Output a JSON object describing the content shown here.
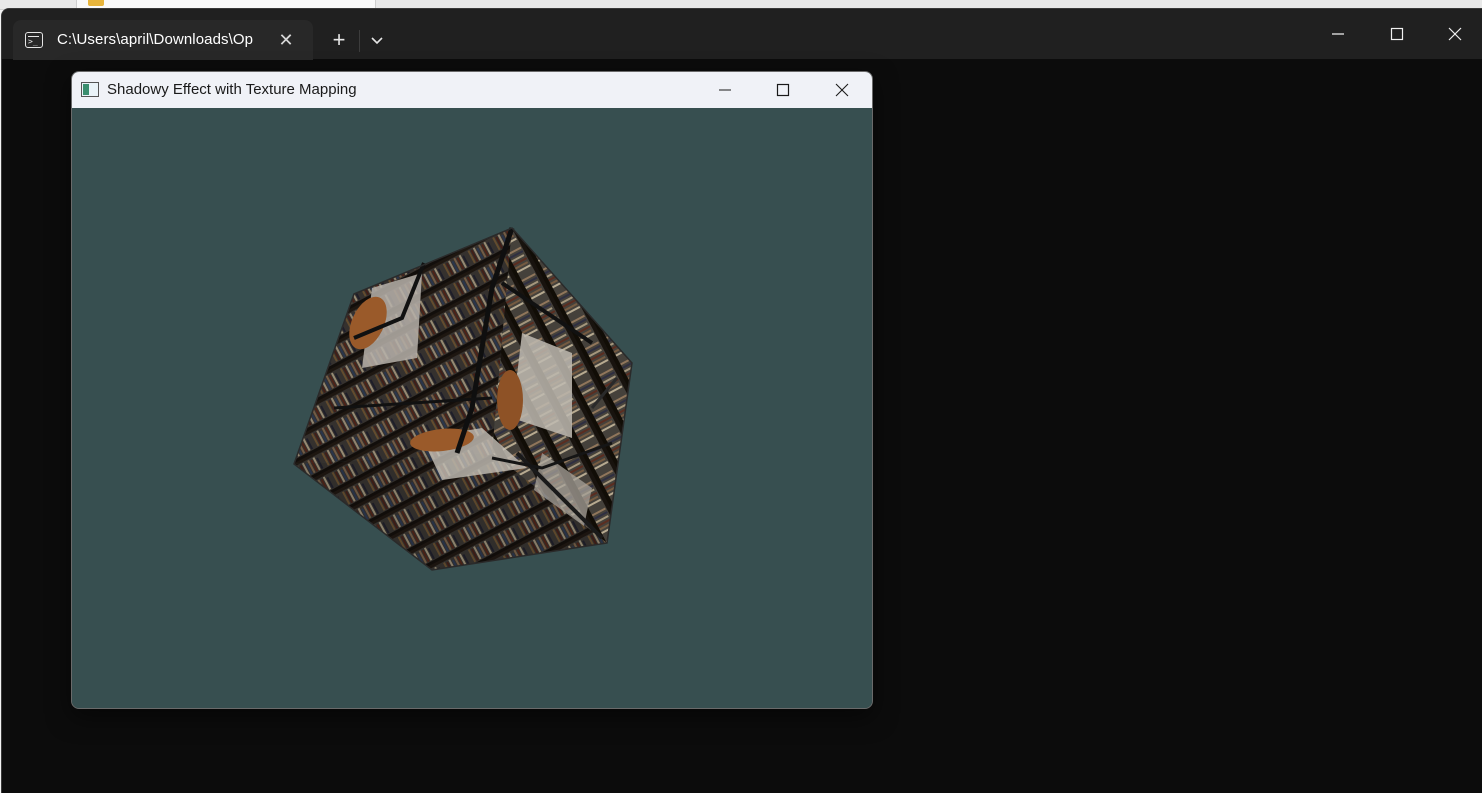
{
  "terminal": {
    "tab_title": "C:\\Users\\april\\Downloads\\Op",
    "tab_close_glyph": "✕",
    "new_tab_glyph": "+",
    "icons": {
      "tab": "terminal-icon",
      "close": "close-icon",
      "new_tab": "plus-icon",
      "dropdown": "chevron-down-icon",
      "minimize": "minimize-icon",
      "maximize": "maximize-icon",
      "window_close": "close-icon"
    },
    "colors": {
      "background": "#0c0c0c",
      "titlebar": "#202020",
      "tab": "#282828"
    }
  },
  "gl_window": {
    "title": "Shadowy Effect with Texture Mapping",
    "icons": {
      "app": "app-window-icon",
      "minimize": "minimize-icon",
      "maximize": "maximize-icon",
      "close": "close-icon"
    },
    "colors": {
      "clear_color": "#374f50",
      "titlebar": "#f0f2f7"
    },
    "scene": {
      "object": "textured-cube",
      "texture": "bookshelf-room"
    }
  }
}
